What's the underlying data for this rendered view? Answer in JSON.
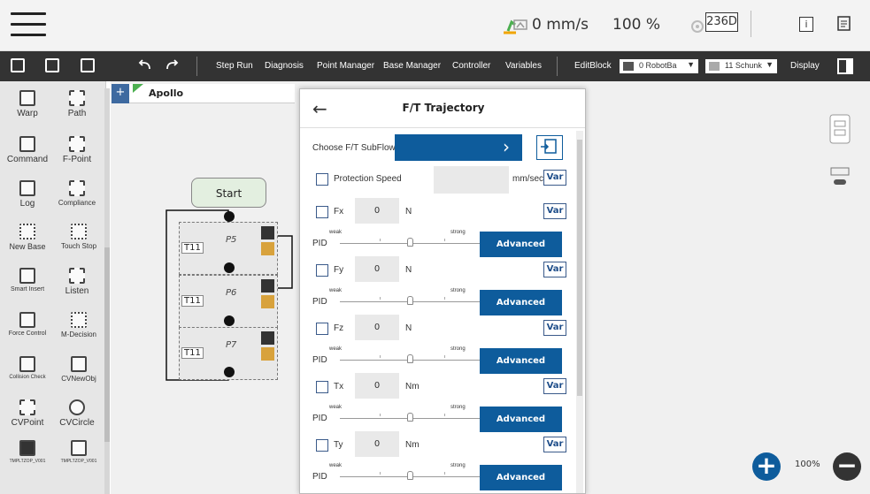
{
  "header": {
    "speed": "0 mm/s",
    "percentage": "100 %",
    "counter": "236D",
    "info_label": "i"
  },
  "toolbar": {
    "step_run": "Step Run",
    "diagnosis": "Diagnosis",
    "point_manager": "Point Manager",
    "base_manager": "Base Manager",
    "controller": "Controller",
    "variables": "Variables",
    "edit_block": "EditBlock",
    "base_select": "0 RobotBa",
    "tool_select": "11 Schunk",
    "display": "Display"
  },
  "sidebar": {
    "items": [
      {
        "label": "Warp"
      },
      {
        "label": "Path"
      },
      {
        "label": "Command"
      },
      {
        "label": "F-Point"
      },
      {
        "label": "Log"
      },
      {
        "label": "Compliance"
      },
      {
        "label": "New Base"
      },
      {
        "label": "Touch Stop"
      },
      {
        "label": "Smart Insert"
      },
      {
        "label": "Listen"
      },
      {
        "label": "Force Control"
      },
      {
        "label": "M-Decision"
      },
      {
        "label": "Collision Check"
      },
      {
        "label": "CVNewObj"
      },
      {
        "label": "CVPoint"
      },
      {
        "label": "CVCircle"
      },
      {
        "label": "TMPLTZOP_V001"
      },
      {
        "label": "TMPLTZOP_V001"
      }
    ]
  },
  "flow": {
    "tab_name": "Apollo",
    "start_label": "Start",
    "blocks": [
      {
        "point": "P5",
        "tag": "T11"
      },
      {
        "point": "P6",
        "tag": "T11"
      },
      {
        "point": "P7",
        "tag": "T11"
      }
    ],
    "zoom": "100%"
  },
  "dialog": {
    "title": "F/T Trajectory",
    "choose_subflow_label": "Choose F/T SubFlow",
    "protection_speed_label": "Protection Speed",
    "protection_speed_unit": "mm/sec",
    "var_label": "Var",
    "pid_label": "PID",
    "weak_label": "weak",
    "strong_label": "strong",
    "advanced_label": "Advanced",
    "axes": [
      {
        "name": "Fx",
        "value": "0",
        "unit": "N"
      },
      {
        "name": "Fy",
        "value": "0",
        "unit": "N"
      },
      {
        "name": "Fz",
        "value": "0",
        "unit": "N"
      },
      {
        "name": "Tx",
        "value": "0",
        "unit": "Nm"
      },
      {
        "name": "Ty",
        "value": "0",
        "unit": "Nm"
      }
    ]
  },
  "colors": {
    "accent_blue": "#0e5c9c",
    "toolbar_bg": "#333333",
    "start_green": "#e3efe0"
  }
}
